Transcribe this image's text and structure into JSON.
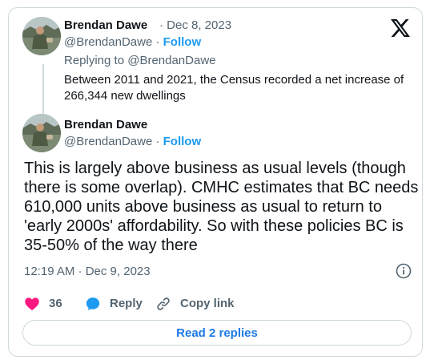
{
  "reply_tweet": {
    "author_name": "Brendan Dawe",
    "date": "· Dec 8, 2023",
    "handle": "@BrendanDawe",
    "separator": " · ",
    "follow": "Follow",
    "replying_to": "Replying to @BrendanDawe",
    "text": "Between 2011 and 2021, the Census recorded a net increase of 266,344 new dwellings"
  },
  "main_tweet": {
    "author_name": "Brendan Dawe",
    "handle": "@BrendanDawe",
    "separator": " · ",
    "follow": "Follow",
    "text": "This is largely above business as usual levels (though there is some overlap).  CMHC estimates that BC needs 610,000  units above business as usual to return to 'early 2000s' affordability. So with these policies BC is 35-50% of the way there",
    "timestamp": "12:19 AM · Dec 9, 2023"
  },
  "actions": {
    "likes": "36",
    "reply": "Reply",
    "copy_link": "Copy link"
  },
  "read_replies": "Read 2 replies",
  "colors": {
    "like": "#f91880",
    "reply": "#1d9bf0",
    "link": "#1d9bf0",
    "border": "#cfd9de",
    "muted": "#536471"
  },
  "icons": [
    "x-logo-icon",
    "heart-icon",
    "comment-icon",
    "link-icon",
    "info-icon"
  ]
}
